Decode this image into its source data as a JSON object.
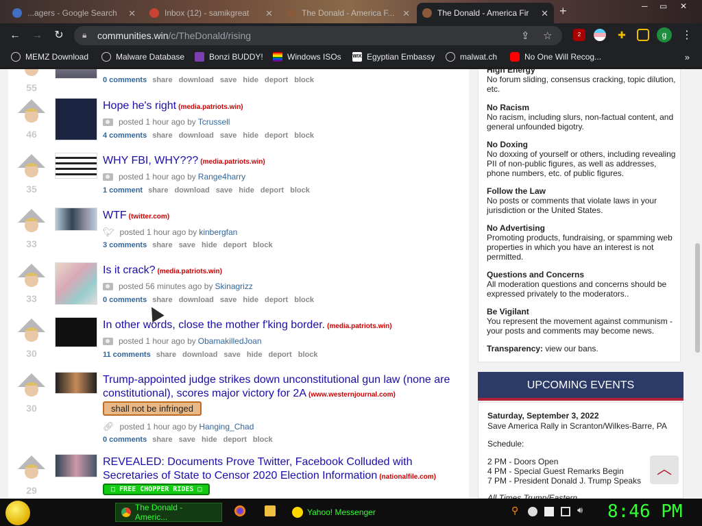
{
  "tabs": [
    {
      "label": "...agers - Google Search",
      "favicon_color": "#4285f4"
    },
    {
      "label": "Inbox (12) - samikgreat",
      "favicon_color": "#ea4335"
    },
    {
      "label": "The Donald - America F...",
      "favicon_color": "#8b5a3a"
    },
    {
      "label": "The Donald - America Fir",
      "favicon_color": "#8b5a3a"
    }
  ],
  "address": {
    "domain": "communities.win",
    "path": "/c/TheDonald/rising"
  },
  "profile_initial": "g",
  "ext_badge": "2",
  "bookmarks": [
    {
      "label": "MEMZ Download",
      "icon": "globe-icon"
    },
    {
      "label": "Malware Database",
      "icon": "globe-icon"
    },
    {
      "label": "Bonzi BUDDY!",
      "icon": "bonzi-icon"
    },
    {
      "label": "Windows ISOs",
      "icon": "rainbow-flag-icon"
    },
    {
      "label": "Egyptian Embassy",
      "icon": "wix-icon"
    },
    {
      "label": "malwat.ch",
      "icon": "globe-icon"
    },
    {
      "label": "No One Will Recog...",
      "icon": "youtube-icon"
    }
  ],
  "posts": [
    {
      "score": "55",
      "title": "",
      "domain": "",
      "meta_prefix": "",
      "time": "",
      "by": "",
      "author": "",
      "comments": "0 comments",
      "actions": [
        "share",
        "download",
        "save",
        "hide",
        "deport",
        "block"
      ],
      "flair": ""
    },
    {
      "score": "46",
      "title": "Hope he's right",
      "domain": "(media.patriots.win)",
      "meta_prefix": "posted",
      "time": "1 hour ago",
      "by": "by",
      "author": "Tcrussell",
      "comments": "4 comments",
      "actions": [
        "share",
        "download",
        "save",
        "hide",
        "deport",
        "block"
      ],
      "flair": ""
    },
    {
      "score": "35",
      "title": "WHY FBI, WHY???",
      "domain": "(media.patriots.win)",
      "meta_prefix": "posted",
      "time": "1 hour ago",
      "by": "by",
      "author": "Range4harry",
      "comments": "1 comment",
      "actions": [
        "share",
        "download",
        "save",
        "hide",
        "deport",
        "block"
      ],
      "flair": ""
    },
    {
      "score": "33",
      "title": "WTF",
      "domain": "(twitter.com)",
      "meta_prefix": "posted",
      "time": "1 hour ago",
      "by": "by",
      "author": "kinbergfan",
      "comments": "3 comments",
      "actions": [
        "share",
        "save",
        "hide",
        "deport",
        "block"
      ],
      "flair": ""
    },
    {
      "score": "33",
      "title": "Is it crack?",
      "domain": "(media.patriots.win)",
      "meta_prefix": "posted",
      "time": "56 minutes ago",
      "by": "by",
      "author": "Skinagrizz",
      "comments": "0 comments",
      "actions": [
        "share",
        "download",
        "save",
        "hide",
        "deport",
        "block"
      ],
      "flair": ""
    },
    {
      "score": "30",
      "title": "In other words, close the mother f'king border.",
      "domain": "(media.patriots.win)",
      "meta_prefix": "posted",
      "time": "1 hour ago",
      "by": "by",
      "author": "ObamakilledJoan",
      "comments": "11 comments",
      "actions": [
        "share",
        "download",
        "save",
        "hide",
        "deport",
        "block"
      ],
      "flair": ""
    },
    {
      "score": "30",
      "title": "Trump-appointed judge strikes down unconstitutional gun law (none are constitutional), scores major victory for 2A",
      "domain": "(www.westernjournal.com)",
      "meta_prefix": "posted",
      "time": "1 hour ago",
      "by": "by",
      "author": "Hanging_Chad",
      "comments": "0 comments",
      "actions": [
        "share",
        "save",
        "hide",
        "deport",
        "block"
      ],
      "flair": "shall not be infringed"
    },
    {
      "score": "29",
      "title": "REVEALED: Documents Prove Twitter, Facebook Colluded with Secretaries of State to Censor 2020 Election Information",
      "domain": "(nationalfile.com)",
      "meta_prefix": "",
      "time": "",
      "by": "",
      "author": "",
      "comments": "",
      "actions": [],
      "flair": "□ FREE CHOPPER RIDES □"
    }
  ],
  "rules": [
    {
      "title": "High Energy",
      "text": "No forum sliding, consensus cracking, topic dilution, etc."
    },
    {
      "title": "No Racism",
      "text": "No racism, including slurs, non-factual content, and general unfounded bigotry."
    },
    {
      "title": "No Doxing",
      "text": "No doxxing of yourself or others, including revealing PII of non-public figures, as well as addresses, phone numbers, etc. of public figures."
    },
    {
      "title": "Follow the Law",
      "text": "No posts or comments that violate laws in your jurisdiction or the United States."
    },
    {
      "title": "No Advertising",
      "text": "Promoting products, fundraising, or spamming web properties in which you have an interest is not permitted."
    },
    {
      "title": "Questions and Concerns",
      "text": "All moderation questions and concerns should be expressed privately to the moderators.."
    },
    {
      "title": "Be Vigilant",
      "text": "You represent the movement against communism - your posts and comments may become news."
    }
  ],
  "transparency": {
    "label": "Transparency:",
    "link": "view our bans."
  },
  "events": {
    "header": "UPCOMING EVENTS",
    "date": "Saturday, September 3, 2022",
    "title": "Save America Rally in Scranton/Wilkes-Barre, PA",
    "schedule_label": "Schedule:",
    "items": [
      "2 PM - Doors Open",
      "4 PM - Special Guest Remarks Begin",
      "7 PM - President Donald J. Trump Speaks"
    ],
    "footer": "All Times Trump/Eastern"
  },
  "taskbar": {
    "tasks": [
      {
        "label": "The Donald - Americ..."
      },
      {
        "label": "Yahoo! Messenger"
      }
    ],
    "clock": "8:46 PM"
  },
  "colors": {
    "link": "#1a0dab",
    "domain": "#cc0000",
    "accent_navy": "#2b3a67",
    "accent_red": "#b22234",
    "clock_green": "#33ff33"
  }
}
